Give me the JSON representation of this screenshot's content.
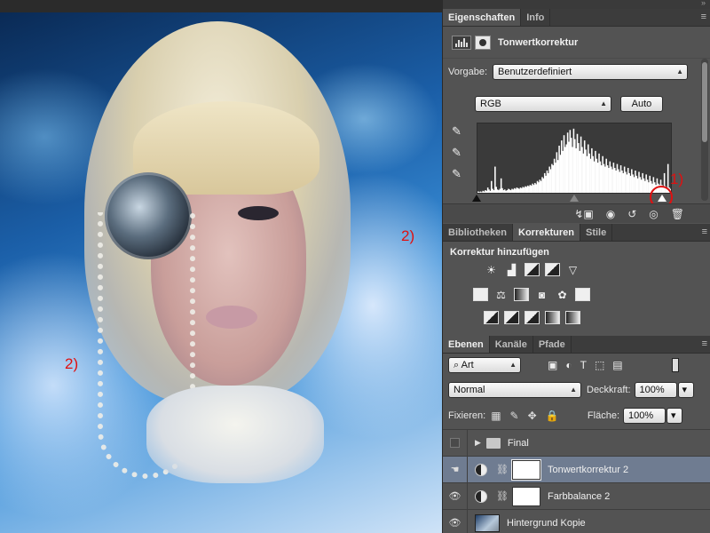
{
  "annotations": {
    "one": "1)",
    "two_right": "2)",
    "two_left": "2)"
  },
  "properties": {
    "tabs": [
      "Eigenschaften",
      "Info"
    ],
    "title": "Tonwertkorrektur",
    "preset_label": "Vorgabe:",
    "preset_value": "Benutzerdefiniert",
    "channel_value": "RGB",
    "auto_label": "Auto",
    "histogram_bars": [
      2,
      1,
      2,
      1,
      3,
      2,
      4,
      3,
      8,
      5,
      3,
      18,
      6,
      4,
      40,
      9,
      5,
      4,
      6,
      22,
      7,
      4,
      5,
      3,
      4,
      6,
      5,
      4,
      6,
      5,
      7,
      6,
      8,
      7,
      6,
      8,
      7,
      9,
      8,
      10,
      9,
      11,
      10,
      12,
      11,
      14,
      12,
      15,
      13,
      18,
      16,
      20,
      18,
      24,
      22,
      30,
      26,
      34,
      30,
      40,
      36,
      44,
      42,
      52,
      46,
      62,
      50,
      72,
      58,
      80,
      64,
      88,
      70,
      74,
      92,
      78,
      96,
      84,
      70,
      98,
      82,
      68,
      90,
      76,
      64,
      86,
      70,
      60,
      80,
      66,
      56,
      74,
      60,
      52,
      68,
      56,
      48,
      64,
      52,
      46,
      60,
      48,
      42,
      56,
      44,
      40,
      52,
      42,
      38,
      48,
      40,
      36,
      46,
      38,
      34,
      44,
      36,
      32,
      42,
      34,
      30,
      40,
      32,
      28,
      38,
      30,
      26,
      36,
      28,
      24,
      34,
      26,
      22,
      32,
      24,
      20,
      30,
      22,
      18,
      28,
      20,
      16,
      26,
      18,
      14,
      24,
      16,
      12,
      22,
      14,
      12,
      20,
      12,
      10,
      30,
      10,
      8,
      44,
      8,
      6
    ],
    "sliders": {
      "black": 0,
      "gray": 0.5,
      "white": 0.95
    }
  },
  "adjustments": {
    "tabs": [
      "Bibliotheken",
      "Korrekturen",
      "Stile"
    ],
    "add_label": "Korrektur hinzufügen"
  },
  "layers": {
    "tabs": [
      "Ebenen",
      "Kanäle",
      "Pfade"
    ],
    "filter_value": "Art",
    "blend_value": "Normal",
    "opacity_label": "Deckkraft:",
    "opacity_value": "100%",
    "lock_label": "Fixieren:",
    "fill_label": "Fläche:",
    "fill_value": "100%",
    "items": [
      {
        "name": "Final"
      },
      {
        "name": "Tonwertkorrektur 2"
      },
      {
        "name": "Farbbalance 2"
      },
      {
        "name": "Hintergrund Kopie"
      }
    ]
  },
  "colors": {
    "panel": "#535353",
    "selected_layer": "#6f7c91",
    "annotation": "#e01010"
  }
}
